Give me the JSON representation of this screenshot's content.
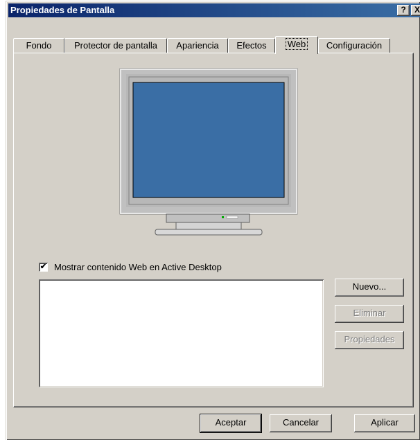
{
  "window": {
    "title": "Propiedades de Pantalla",
    "help_label": "?",
    "close_label": "X"
  },
  "tabs": [
    {
      "label": "Fondo"
    },
    {
      "label": "Protector de pantalla"
    },
    {
      "label": "Apariencia"
    },
    {
      "label": "Efectos"
    },
    {
      "label": "Web"
    },
    {
      "label": "Configuración"
    }
  ],
  "active_tab": "Web",
  "web": {
    "checkbox_label": "Mostrar contenido Web en Active Desktop",
    "checkbox_checked": true,
    "new_button": "Nuevo...",
    "delete_button": "Eliminar",
    "properties_button": "Propiedades"
  },
  "footer": {
    "ok": "Aceptar",
    "cancel": "Cancelar",
    "apply": "Aplicar"
  },
  "colors": {
    "screen": "#3a6ea5",
    "face": "#d4d0c8"
  }
}
